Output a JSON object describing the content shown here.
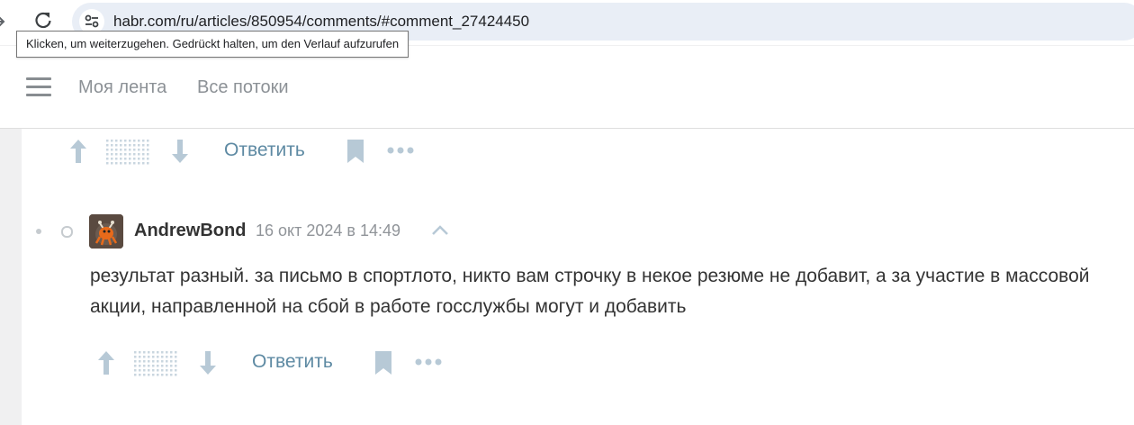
{
  "browser": {
    "url": "habr.com/ru/articles/850954/comments/#comment_27424450",
    "tooltip": "Klicken, um weiterzugehen. Gedrückt halten, um den Verlauf aufzurufen"
  },
  "header": {
    "nav": [
      {
        "label": "Моя лента"
      },
      {
        "label": "Все потоки"
      }
    ]
  },
  "comments": [
    {
      "actions": {
        "reply_label": "Ответить"
      }
    },
    {
      "author": "AndrewBond",
      "date": "16 окт 2024 в 14:49",
      "text": "результат разный. за письмо в спортлото, никто вам строчку в некое резюме не добавит, а за участие в массовой акции, направленной на сбой в работе госслужбы могут и добавить",
      "actions": {
        "reply_label": "Ответить"
      }
    }
  ],
  "colors": {
    "accent_link": "#5e8aa3",
    "vote_icon": "#b7c9d6"
  },
  "icons": [
    "forward-icon",
    "reload-icon",
    "site-settings-icon",
    "menu-icon",
    "upvote-icon",
    "vote-score-placeholder-icon",
    "downvote-icon",
    "bookmark-icon",
    "more-icon",
    "collapse-thread-icon"
  ]
}
